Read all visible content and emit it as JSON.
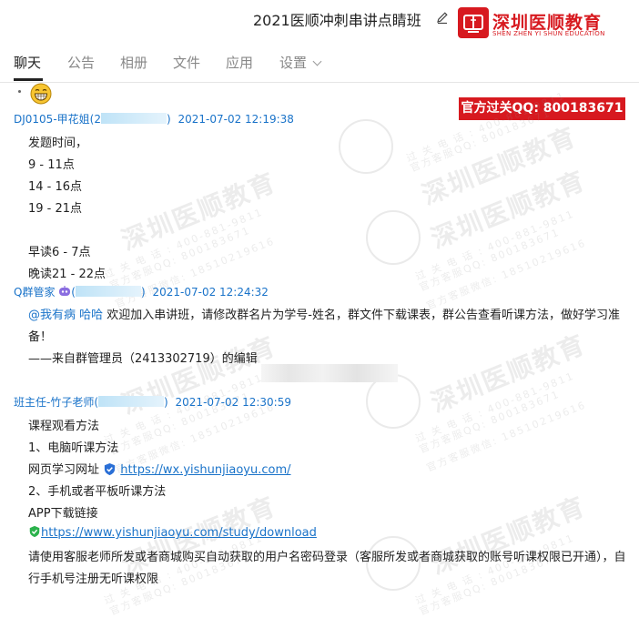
{
  "window": {
    "title": "2021医顺冲刺串讲点睛班"
  },
  "logo": {
    "name_cn": "深圳医顺教育",
    "name_en": "SHEN ZHEN YI SHUN EDUCATION"
  },
  "tabs": [
    {
      "label": "聊天",
      "active": true
    },
    {
      "label": "公告"
    },
    {
      "label": "相册"
    },
    {
      "label": "文件"
    },
    {
      "label": "应用"
    },
    {
      "label": "设置"
    }
  ],
  "banner": {
    "text": "官方过关QQ: 800183671"
  },
  "watermark": {
    "brand": "深圳医顺教育",
    "phone": "过 关 电 话 : 400-881-9811",
    "qq": "官方客服QQ: 800183671",
    "wechat": "官方客服微信: 18510219616"
  },
  "messages": [
    {
      "sender": "DJ0105-甲花姐(2",
      "sender_suffix": ")",
      "time": "2021-07-02 12:19:38",
      "lines": [
        "发题时间，",
        "9 - 11点",
        "14 - 16点",
        "19 - 21点",
        "早读6 - 7点",
        "晚读21 - 22点"
      ]
    },
    {
      "sender": "Q群管家",
      "sender_prefix_paren": "(",
      "sender_suffix": ")",
      "time": "2021-07-02 12:24:32",
      "mention": "@我有病 哈哈",
      "text1": " 欢迎加入串讲班，请修改群名片为学号-姓名，群文件下载课表，群公告查看听课方法，做好学习准",
      "text2": "备！",
      "text3": "——来自群管理员（2413302719）的编辑"
    },
    {
      "sender": "班主任-竹子老师(",
      "sender_suffix": ")",
      "time": "2021-07-02 12:30:59",
      "line1": "课程观看方法",
      "line2": "1、电脑听课方法",
      "line3_label": "网页学习网址",
      "line3_link": "https://wx.yishunjiaoyu.com/",
      "line4": "2、手机或者平板听课方法",
      "line5": "APP下载链接",
      "line6_link": "https://www.yishunjiaoyu.com/study/download",
      "line7": "请使用客服老师所发或者商城购买自动获取的用户名密码登录（客服所发或者商城获取的账号听课权限已开通），自",
      "line8": "行手机号注册无听课权限"
    }
  ]
}
